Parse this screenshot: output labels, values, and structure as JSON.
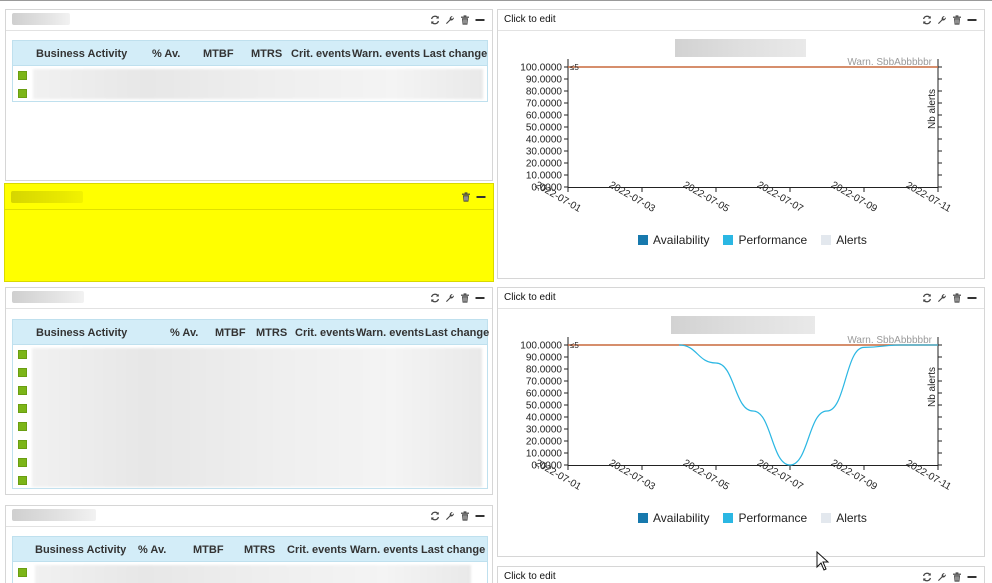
{
  "tables": {
    "headers": [
      "Business Activity",
      "% Av.",
      "MTBF",
      "MTRS",
      "Crit. events",
      "Warn. events",
      "Last change"
    ],
    "status_color": "#7cb518",
    "header_bg": "#d3edf8"
  },
  "chart_widget": {
    "title": "Click to edit",
    "legend": [
      {
        "name": "Availability",
        "color": "#1779ad"
      },
      {
        "name": "Performance",
        "color": "#2bb7e3"
      },
      {
        "name": "Alerts",
        "color": "#e3e8ee"
      }
    ],
    "right_axis_label": "Nb alerts",
    "annotation": "Warn. SbbAbbbbbr",
    "threshold_marker": "≤5"
  },
  "chart_data": [
    {
      "type": "line",
      "title": "",
      "ylabel": "",
      "y2label": "Nb alerts",
      "ylim": [
        0,
        100
      ],
      "yticks": [
        "100.0000",
        "90.0000",
        "80.0000",
        "70.0000",
        "60.0000",
        "50.0000",
        "40.0000",
        "30.0000",
        "20.0000",
        "10.0000",
        "0.0000"
      ],
      "xticks": [
        "2022-07-01",
        "2022-07-03",
        "2022-07-05",
        "2022-07-07",
        "2022-07-09",
        "2022-07-11"
      ],
      "series": [
        {
          "name": "Availability",
          "color": "#c8683c",
          "x": [
            "2022-07-01",
            "2022-07-11"
          ],
          "values": [
            100,
            100
          ]
        }
      ]
    },
    {
      "type": "line",
      "title": "",
      "ylabel": "",
      "y2label": "Nb alerts",
      "ylim": [
        0,
        100
      ],
      "yticks": [
        "100.0000",
        "90.0000",
        "80.0000",
        "70.0000",
        "60.0000",
        "50.0000",
        "40.0000",
        "30.0000",
        "20.0000",
        "10.0000",
        "0.0000"
      ],
      "xticks": [
        "2022-07-01",
        "2022-07-03",
        "2022-07-05",
        "2022-07-07",
        "2022-07-09",
        "2022-07-11"
      ],
      "series": [
        {
          "name": "Availability",
          "color": "#c8683c",
          "x": [
            "2022-07-01",
            "2022-07-11"
          ],
          "values": [
            100,
            100
          ]
        },
        {
          "name": "Performance",
          "color": "#2bb7e3",
          "x": [
            "2022-07-04",
            "2022-07-05",
            "2022-07-06",
            "2022-07-07",
            "2022-07-08",
            "2022-07-09",
            "2022-07-10",
            "2022-07-11"
          ],
          "values": [
            100,
            85,
            45,
            0,
            45,
            98,
            100,
            100
          ]
        }
      ]
    }
  ]
}
